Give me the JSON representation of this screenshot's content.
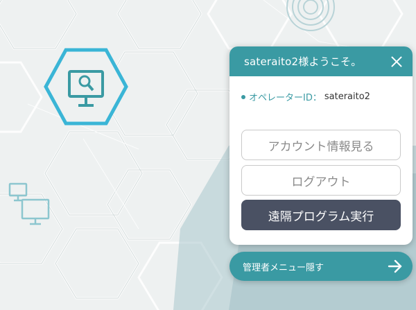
{
  "panel": {
    "title": "sateraito2様ようこそ。",
    "operator_label": "オペレーターID：",
    "operator_id": "sateraito2",
    "buttons": {
      "account": "アカウント情報見る",
      "logout": "ログアウト",
      "run_remote": "遠隔プログラム実行"
    }
  },
  "menu_bar": {
    "label": "管理者メニュー隠す"
  },
  "icons": {
    "close": "close-icon",
    "arrow": "arrow-right-icon",
    "monitor_search": "monitor-search-icon",
    "network": "network-computers-icon"
  },
  "colors": {
    "accent": "#3a9aa3",
    "dark_button": "#4a5163",
    "background": "#eef1f1"
  }
}
